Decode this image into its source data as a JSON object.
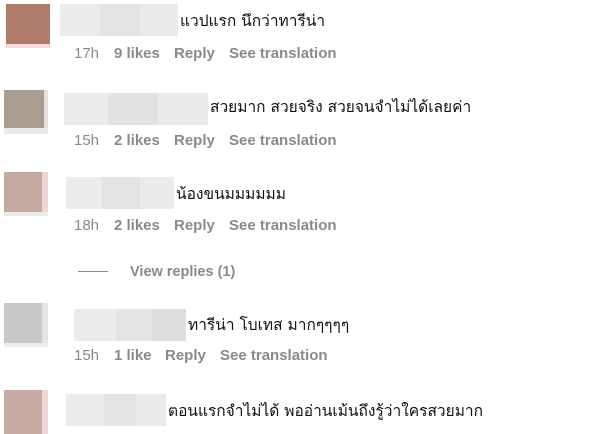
{
  "comments": [
    {
      "text": "แวปแรก นึกว่าทารีน่า",
      "time": "17h",
      "likes": "9 likes",
      "reply": "Reply",
      "translate": "See translation"
    },
    {
      "text": "สวยมาก สวยจริง สวยจนจำไม่ได้เลยค่า",
      "time": "15h",
      "likes": "2 likes",
      "reply": "Reply",
      "translate": "See translation"
    },
    {
      "text": "น้องขนมมมมมม",
      "time": "18h",
      "likes": "2 likes",
      "reply": "Reply",
      "translate": "See translation"
    },
    {
      "text": "ทารีน่า โบเทส มากๆๆๆๆ",
      "time": "15h",
      "likes": "1 like",
      "reply": "Reply",
      "translate": "See translation"
    },
    {
      "text": "ตอนแรกจำไม่ได้ พออ่านเม้นถึงรู้ว่าใครสวยมาก"
    }
  ],
  "view_replies": {
    "label": "View replies (1)"
  },
  "colors": {
    "meta_text": "#8a8a8a",
    "comment_text": "#111111",
    "background": "#ffffff",
    "avatar_1": "#b07a68",
    "avatar_2": "#a99d92",
    "avatar_3": "#c4aaa2",
    "avatar_4": "#c8cac8",
    "avatar_5": "#c9aaa5",
    "blur_light": "#ececec",
    "blur_mid": "#e2e2e2"
  }
}
